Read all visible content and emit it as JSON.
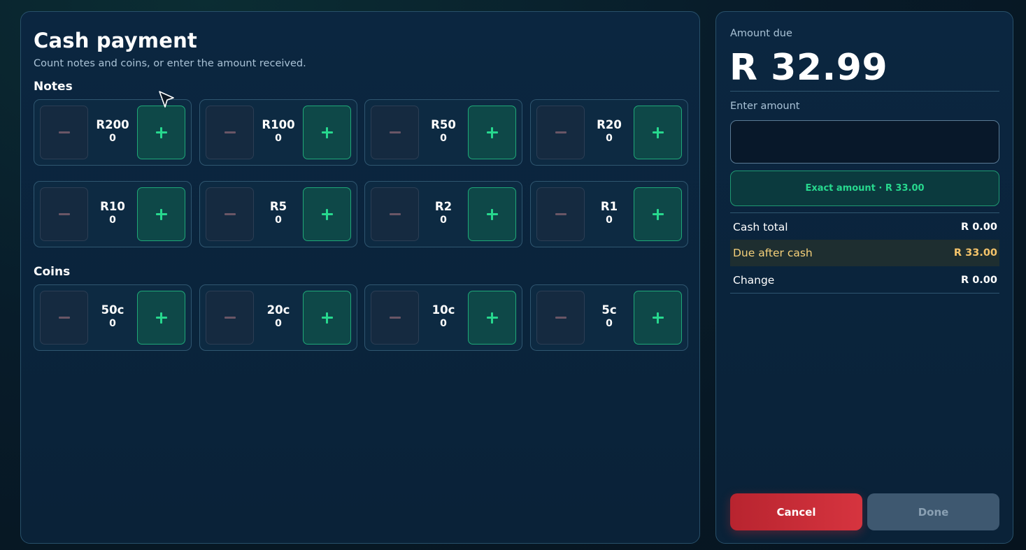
{
  "cash_payment": {
    "title": "Cash payment",
    "subtitle": "Count notes and coins, or enter the amount received.",
    "notes_label": "Notes",
    "coins_label": "Coins",
    "notes": [
      {
        "label": "R200",
        "count": "0"
      },
      {
        "label": "R100",
        "count": "0"
      },
      {
        "label": "R50",
        "count": "0"
      },
      {
        "label": "R20",
        "count": "0"
      },
      {
        "label": "R10",
        "count": "0"
      },
      {
        "label": "R5",
        "count": "0"
      },
      {
        "label": "R2",
        "count": "0"
      },
      {
        "label": "R1",
        "count": "0"
      }
    ],
    "coins": [
      {
        "label": "50c",
        "count": "0"
      },
      {
        "label": "20c",
        "count": "0"
      },
      {
        "label": "10c",
        "count": "0"
      },
      {
        "label": "5c",
        "count": "0"
      }
    ]
  },
  "summary": {
    "amount_due_label": "Amount due",
    "amount_due_value": "R 32.99",
    "enter_amount_label": "Enter amount",
    "enter_amount_value": "",
    "exact_amount_label": "Exact amount · R 33.00",
    "cash_total_label": "Cash total",
    "cash_total_value": "R 0.00",
    "due_after_cash_label": "Due after cash",
    "due_after_cash_value": "R 33.00",
    "change_label": "Change",
    "change_value": "R 0.00",
    "cancel_label": "Cancel",
    "done_label": "Done"
  },
  "colors": {
    "accent_green": "#27d88e",
    "danger_red": "#d6343f",
    "warning_amber": "#f5c46a",
    "panel_bg": "#0b2640"
  },
  "icons": {
    "decrement": "minus-icon",
    "increment": "plus-icon",
    "pointer": "mouse-cursor-icon"
  }
}
